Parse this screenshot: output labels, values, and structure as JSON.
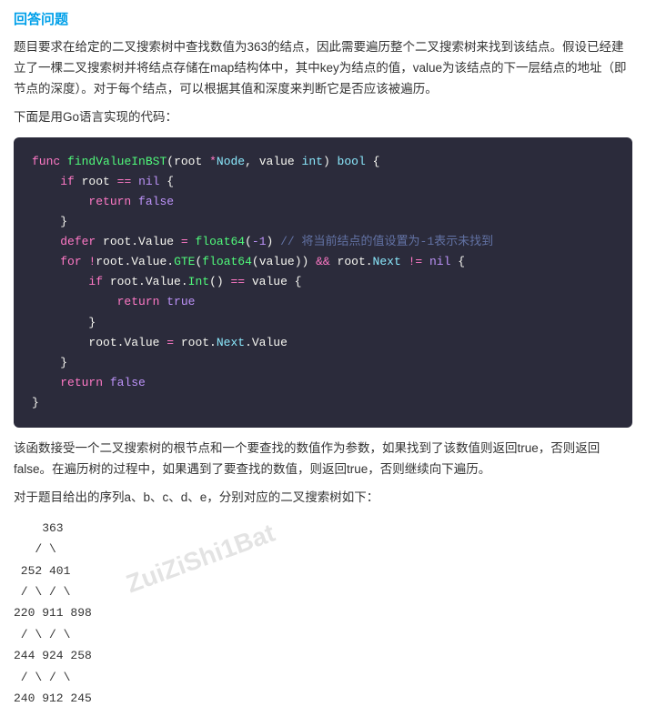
{
  "page": {
    "title": "回答问题",
    "description1": "题目要求在给定的二叉搜索树中查找数值为363的结点，因此需要遍历整个二叉搜索树来找到该结点。假设已经建立了一棵二叉搜索树并将结点存储在map结构体中，其中key为结点的值，value为该结点的下一层结点的地址（即节点的深度）。对于每个结点，可以根据其值和深度来判断它是否应该被遍历。",
    "description2": "下面是用Go语言实现的代码：",
    "code": [
      {
        "line": "func findValueInBST(root *Node, value int) bool {"
      },
      {
        "line": "    if root == nil {"
      },
      {
        "line": "        return false"
      },
      {
        "line": "    }"
      },
      {
        "line": "    defer root.Value = float64(-1) // 将当前结点的值设置为-1表示未找到"
      },
      {
        "line": "    for !root.Value.GTE(float64(value)) && root.Next != nil {"
      },
      {
        "line": "        if root.Value.Int() == value {"
      },
      {
        "line": "            return true"
      },
      {
        "line": "        }"
      },
      {
        "line": "        root.Value = root.Next.Value"
      },
      {
        "line": "    }"
      },
      {
        "line": "    return false"
      },
      {
        "line": "}"
      }
    ],
    "summary": "该函数接受一个二叉搜索树的根节点和一个要查找的数值作为参数，如果找到了该数值则返回true，否则返回false。在遍历树的过程中，如果遇到了要查找的数值，则返回true，否则继续向下遍历。",
    "section_label": "对于题目给出的序列a、b、c、d、e，分别对应的二叉搜索树如下：",
    "tree": {
      "watermark": "ZuiZiShi1Bat",
      "lines": [
        "    363",
        "   / \\",
        " 252 401",
        " / \\ / \\",
        "220 911 898",
        " / \\ / \\",
        "244 924 258",
        " / \\ / \\",
        "240 912 245"
      ]
    }
  }
}
